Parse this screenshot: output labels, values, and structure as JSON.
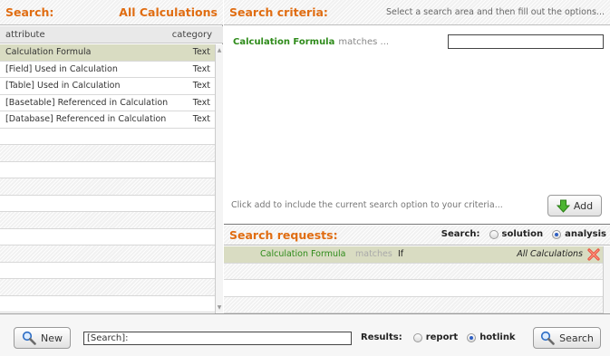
{
  "left_panel": {
    "title": "Search:",
    "scope": "All Calculations",
    "columns": {
      "attribute": "attribute",
      "category": "category"
    },
    "rows": [
      {
        "attribute": "Calculation Formula",
        "category": "Text"
      },
      {
        "attribute": "[Field] Used in Calculation",
        "category": "Text"
      },
      {
        "attribute": "[Table] Used in Calculation",
        "category": "Text"
      },
      {
        "attribute": "[Basetable] Referenced in Calculation",
        "category": "Text"
      },
      {
        "attribute": "[Database] Referenced in Calculation",
        "category": "Text"
      }
    ]
  },
  "criteria": {
    "title": "Search criteria:",
    "hint": "Select a search area and then fill out the options...",
    "field": "Calculation Formula",
    "operator": "matches ...",
    "value": "",
    "add_hint": "Click add to include the current search option to your criteria...",
    "add_label": "Add"
  },
  "requests": {
    "title": "Search requests:",
    "search_label": "Search:",
    "options": {
      "solution": "solution",
      "analysis": "analysis"
    },
    "selected": "analysis",
    "rows": [
      {
        "field": "Calculation Formula",
        "operator": "matches",
        "value": "If",
        "scope": "All Calculations"
      }
    ]
  },
  "bottom": {
    "new_label": "New",
    "query_value": "[Search]:",
    "results_label": "Results:",
    "results_options": {
      "report": "report",
      "hotlink": "hotlink"
    },
    "results_selected": "hotlink",
    "search_label": "Search"
  },
  "colors": {
    "header_orange": "#e06d12",
    "field_green": "#2e8b1a",
    "selected_row": "#d9dcc2",
    "radio_on": "#2f5fc2"
  },
  "icons": {
    "add": "green-down-arrow-icon",
    "new": "magnifier-icon",
    "search": "magnifier-icon",
    "delete": "red-x-icon"
  }
}
